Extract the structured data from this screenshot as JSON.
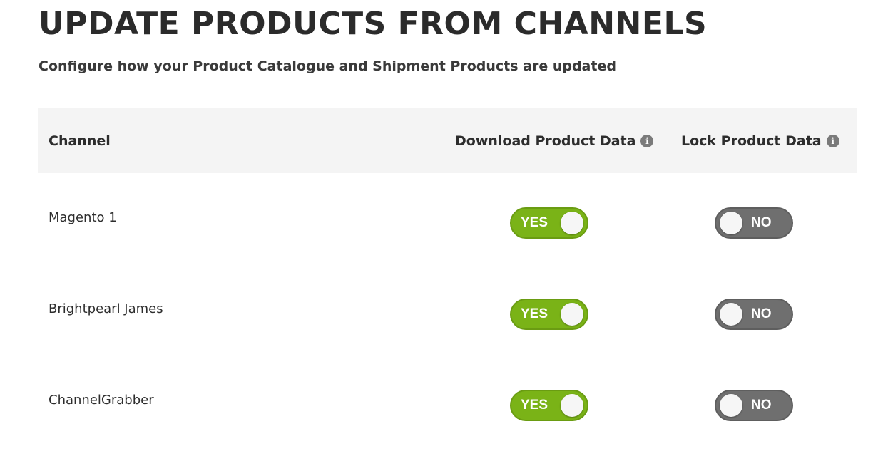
{
  "header": {
    "title": "UPDATE PRODUCTS FROM CHANNELS",
    "subtitle": "Configure how your Product Catalogue and Shipment Products are updated"
  },
  "table": {
    "columns": {
      "channel": "Channel",
      "download": "Download Product Data",
      "lock": "Lock Product Data"
    },
    "info_icon": "info-icon",
    "rows": [
      {
        "channel": "Magento 1",
        "download": "YES",
        "lock": "NO"
      },
      {
        "channel": "Brightpearl James",
        "download": "YES",
        "lock": "NO"
      },
      {
        "channel": "ChannelGrabber",
        "download": "YES",
        "lock": "NO"
      }
    ]
  },
  "colors": {
    "toggle_on": "#7ab317",
    "toggle_off": "#6f6f6f",
    "header_bg": "#f4f4f4"
  }
}
